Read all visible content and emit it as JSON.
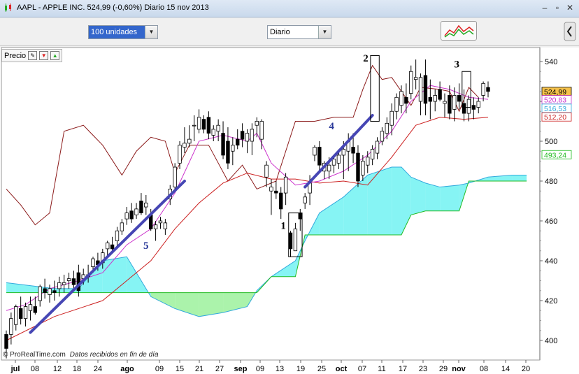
{
  "window": {
    "title": "AAPL - APPLE INC.     524,99 (-0,60%)     Diario  15 nov 2013"
  },
  "toolbar": {
    "units_select": "100 unidades",
    "period_select": "Diario"
  },
  "panel": {
    "label": "Precio"
  },
  "footer": {
    "source": "© ProRealTime.com",
    "note": "Datos recibidos en fin de día"
  },
  "colors": {
    "up_candle": "#ffffff",
    "down_candle": "#000000",
    "tenkan": "#cc33cc",
    "kijun": "#cc2020",
    "chikou": "#8b1a1a",
    "senkou_a": "#33aadd",
    "senkou_b": "#22bb22",
    "cloud_bull": "#5ef0f0",
    "cloud_bear": "#88ee88",
    "trendline": "#4646b4",
    "annotation": "#2b3a9a"
  },
  "chart_data": {
    "type": "candlestick",
    "ylim": [
      390,
      548
    ],
    "y_ticks": [
      400,
      420,
      440,
      460,
      480,
      500,
      520,
      540
    ],
    "x_tick_labels": [
      "jul",
      "08",
      "12",
      "18",
      "24",
      "ago",
      "09",
      "15",
      "21",
      "27",
      "sep",
      "09",
      "13",
      "19",
      "25",
      "oct",
      "07",
      "11",
      "17",
      "23",
      "29",
      "nov",
      "08",
      "14",
      "20"
    ],
    "last_values": [
      {
        "label": "524,99",
        "color": "#000000",
        "bg": "#f6c24a"
      },
      {
        "label": "520,83",
        "color": "#cc33cc",
        "bg": "#ffffff"
      },
      {
        "label": "516,53",
        "color": "#33aadd",
        "bg": "#ffffff"
      },
      {
        "label": "512,20",
        "color": "#cc2020",
        "bg": "#ffffff"
      },
      {
        "label": "493,24",
        "color": "#22bb22",
        "bg": "#ffffff"
      }
    ],
    "candles": [
      [
        403,
        405,
        391,
        396
      ],
      [
        403,
        414,
        398,
        411
      ],
      [
        408,
        418,
        405,
        417
      ],
      [
        416,
        422,
        408,
        411
      ],
      [
        411,
        419,
        407,
        417
      ],
      [
        415,
        422,
        410,
        418
      ],
      [
        417,
        422,
        413,
        414
      ],
      [
        420,
        428,
        417,
        427
      ],
      [
        426,
        431,
        421,
        424
      ],
      [
        423,
        428,
        419,
        426
      ],
      [
        425,
        430,
        420,
        424
      ],
      [
        426,
        432,
        422,
        429
      ],
      [
        428,
        433,
        424,
        429
      ],
      [
        430,
        434,
        426,
        431
      ],
      [
        431,
        435,
        426,
        428
      ],
      [
        434,
        438,
        422,
        425
      ],
      [
        431,
        436,
        428,
        433
      ],
      [
        433,
        438,
        429,
        432
      ],
      [
        437,
        442,
        434,
        441
      ],
      [
        440,
        444,
        435,
        438
      ],
      [
        439,
        446,
        436,
        444
      ],
      [
        446,
        450,
        442,
        449
      ],
      [
        448,
        452,
        444,
        446
      ],
      [
        450,
        457,
        447,
        455
      ],
      [
        455,
        461,
        453,
        459
      ],
      [
        461,
        467,
        458,
        464
      ],
      [
        465,
        469,
        459,
        461
      ],
      [
        463,
        469,
        461,
        466
      ],
      [
        470,
        474,
        463,
        464
      ],
      [
        467,
        473,
        463,
        469
      ],
      [
        463,
        466,
        455,
        456
      ],
      [
        456,
        460,
        450,
        458
      ],
      [
        459,
        462,
        456,
        460
      ],
      [
        456,
        461,
        453,
        459
      ],
      [
        471,
        478,
        468,
        476
      ],
      [
        477,
        489,
        476,
        487
      ],
      [
        489,
        500,
        486,
        498
      ],
      [
        497,
        507,
        494,
        499
      ],
      [
        499,
        508,
        497,
        501
      ],
      [
        508,
        513,
        500,
        508
      ],
      [
        506,
        516,
        504,
        512
      ],
      [
        511,
        513,
        504,
        506
      ],
      [
        512,
        515,
        501,
        504
      ],
      [
        503,
        508,
        500,
        506
      ],
      [
        505,
        511,
        500,
        508
      ],
      [
        504,
        510,
        491,
        493
      ],
      [
        500,
        507,
        486,
        489
      ],
      [
        495,
        502,
        488,
        498
      ],
      [
        501,
        506,
        496,
        498
      ],
      [
        505,
        509,
        497,
        501
      ],
      [
        500,
        506,
        494,
        504
      ],
      [
        500,
        509,
        493,
        506
      ],
      [
        508,
        512,
        502,
        510
      ],
      [
        501,
        511,
        496,
        510
      ],
      [
        482,
        490,
        477,
        488
      ],
      [
        475,
        481,
        463,
        477
      ],
      [
        475,
        480,
        471,
        474
      ],
      [
        474,
        477,
        461,
        466
      ],
      [
        474,
        484,
        468,
        482
      ],
      [
        454,
        455,
        442,
        446
      ],
      [
        445,
        459,
        445,
        456
      ],
      [
        464,
        466,
        455,
        461
      ],
      [
        469,
        474,
        466,
        472
      ],
      [
        474,
        483,
        468,
        479
      ],
      [
        493,
        498,
        490,
        497
      ],
      [
        497,
        500,
        485,
        488
      ],
      [
        485,
        490,
        481,
        489
      ],
      [
        485,
        492,
        481,
        488
      ],
      [
        488,
        493,
        484,
        491
      ],
      [
        489,
        496,
        486,
        493
      ],
      [
        493,
        500,
        481,
        496
      ],
      [
        495,
        504,
        485,
        500
      ],
      [
        497,
        504,
        489,
        494
      ],
      [
        494,
        498,
        477,
        480
      ],
      [
        483,
        493,
        480,
        490
      ],
      [
        488,
        495,
        484,
        492
      ],
      [
        491,
        498,
        488,
        496
      ],
      [
        494,
        502,
        491,
        500
      ],
      [
        500,
        507,
        498,
        505
      ],
      [
        504,
        512,
        501,
        509
      ],
      [
        508,
        519,
        503,
        515
      ],
      [
        515,
        524,
        511,
        522
      ],
      [
        518,
        528,
        514,
        525
      ],
      [
        522,
        529,
        514,
        519
      ],
      [
        524,
        538,
        521,
        535
      ],
      [
        531,
        541,
        526,
        532
      ],
      [
        520,
        534,
        513,
        532
      ],
      [
        533,
        541,
        513,
        519
      ],
      [
        522,
        531,
        511,
        520
      ],
      [
        520,
        526,
        515,
        523
      ],
      [
        526,
        530,
        520,
        521
      ],
      [
        519,
        524,
        512,
        520
      ],
      [
        523,
        528,
        511,
        514
      ],
      [
        516,
        527,
        510,
        523
      ],
      [
        523,
        529,
        516,
        520
      ],
      [
        519,
        526,
        510,
        514
      ],
      [
        514,
        523,
        510,
        521
      ],
      [
        518,
        522,
        511,
        516
      ],
      [
        517,
        522,
        514,
        520
      ],
      [
        523,
        530,
        520,
        529
      ],
      [
        527,
        530,
        522,
        525
      ]
    ],
    "tenkan_sen": [
      [
        0,
        415
      ],
      [
        4,
        418
      ],
      [
        9,
        426
      ],
      [
        15,
        430
      ],
      [
        20,
        434
      ],
      [
        25,
        448
      ],
      [
        30,
        456
      ],
      [
        35,
        474
      ],
      [
        40,
        500
      ],
      [
        45,
        503
      ],
      [
        50,
        500
      ],
      [
        52,
        504
      ],
      [
        55,
        489
      ],
      [
        60,
        478
      ],
      [
        65,
        480
      ],
      [
        70,
        485
      ],
      [
        75,
        493
      ],
      [
        80,
        505
      ],
      [
        84,
        520
      ],
      [
        88,
        528
      ],
      [
        92,
        526
      ],
      [
        96,
        522
      ],
      [
        100,
        521
      ]
    ],
    "kijun_sen": [
      [
        0,
        400
      ],
      [
        10,
        412
      ],
      [
        20,
        420
      ],
      [
        25,
        430
      ],
      [
        30,
        440
      ],
      [
        35,
        456
      ],
      [
        40,
        469
      ],
      [
        45,
        479
      ],
      [
        50,
        484
      ],
      [
        55,
        481
      ],
      [
        60,
        481
      ],
      [
        65,
        479
      ],
      [
        70,
        480
      ],
      [
        75,
        478
      ],
      [
        80,
        492
      ],
      [
        85,
        508
      ],
      [
        90,
        512
      ],
      [
        95,
        511
      ],
      [
        100,
        512
      ]
    ],
    "chikou_span": [
      [
        0,
        476
      ],
      [
        3,
        468
      ],
      [
        6,
        458
      ],
      [
        9,
        464
      ],
      [
        12,
        505
      ],
      [
        16,
        508
      ],
      [
        20,
        498
      ],
      [
        24,
        483
      ],
      [
        27,
        495
      ],
      [
        30,
        502
      ],
      [
        33,
        500
      ],
      [
        35,
        484
      ],
      [
        38,
        498
      ],
      [
        42,
        498
      ],
      [
        46,
        480
      ],
      [
        49,
        488
      ],
      [
        52,
        476
      ],
      [
        56,
        480
      ],
      [
        60,
        510
      ],
      [
        64,
        510
      ],
      [
        68,
        512
      ],
      [
        72,
        512
      ],
      [
        74,
        526
      ],
      [
        76,
        538
      ],
      [
        78,
        531
      ],
      [
        80,
        532
      ],
      [
        84,
        518
      ],
      [
        86,
        527
      ],
      [
        90,
        526
      ],
      [
        92,
        525
      ],
      [
        94,
        515
      ],
      [
        96,
        527
      ],
      [
        98,
        522
      ]
    ],
    "senkou_a": [
      [
        0,
        429
      ],
      [
        10,
        426
      ],
      [
        15,
        426
      ],
      [
        20,
        440
      ],
      [
        25,
        442
      ],
      [
        30,
        422
      ],
      [
        35,
        416
      ],
      [
        40,
        412
      ],
      [
        45,
        414
      ],
      [
        50,
        417
      ],
      [
        52,
        425
      ],
      [
        55,
        432
      ],
      [
        60,
        440
      ],
      [
        62,
        450
      ],
      [
        65,
        464
      ],
      [
        70,
        472
      ],
      [
        75,
        483
      ],
      [
        80,
        487
      ],
      [
        82,
        487
      ],
      [
        84,
        482
      ],
      [
        87,
        479
      ],
      [
        90,
        477
      ],
      [
        94,
        478
      ],
      [
        96,
        479
      ],
      [
        100,
        482
      ],
      [
        105,
        483
      ],
      [
        108,
        483
      ]
    ],
    "senkou_b": [
      [
        0,
        424
      ],
      [
        10,
        424
      ],
      [
        15,
        424
      ],
      [
        20,
        424
      ],
      [
        25,
        424
      ],
      [
        30,
        424
      ],
      [
        35,
        424
      ],
      [
        40,
        424
      ],
      [
        45,
        424
      ],
      [
        50,
        424
      ],
      [
        52,
        424
      ],
      [
        55,
        432
      ],
      [
        60,
        432
      ],
      [
        62,
        453
      ],
      [
        65,
        453
      ],
      [
        70,
        453
      ],
      [
        75,
        453
      ],
      [
        80,
        453
      ],
      [
        82,
        453
      ],
      [
        84,
        463
      ],
      [
        87,
        465
      ],
      [
        90,
        465
      ],
      [
        94,
        465
      ],
      [
        96,
        480
      ],
      [
        100,
        480
      ],
      [
        105,
        480
      ],
      [
        108,
        480
      ]
    ],
    "trendlines": [
      {
        "x1": 5,
        "y1": 404,
        "x2": 37,
        "y2": 480
      },
      {
        "x1": 62,
        "y1": 477,
        "x2": 76,
        "y2": 513
      }
    ],
    "boxes": [
      {
        "label": "1",
        "x1": 58.6,
        "x2": 61.4,
        "y1": 442,
        "y2": 464
      },
      {
        "label": "2",
        "x1": 75.6,
        "x2": 77.4,
        "y1": 510,
        "y2": 543
      },
      {
        "label": "3",
        "x1": 94.6,
        "x2": 96.4,
        "y1": 517,
        "y2": 535
      }
    ],
    "annotations": [
      {
        "text": "1",
        "x": 57.5,
        "y": 456
      },
      {
        "text": "2",
        "x": 74.6,
        "y": 540
      },
      {
        "text": "3",
        "x": 93.5,
        "y": 537
      },
      {
        "text": "4",
        "x": 67.5,
        "y": 506
      },
      {
        "text": "5",
        "x": 29,
        "y": 446
      }
    ]
  }
}
